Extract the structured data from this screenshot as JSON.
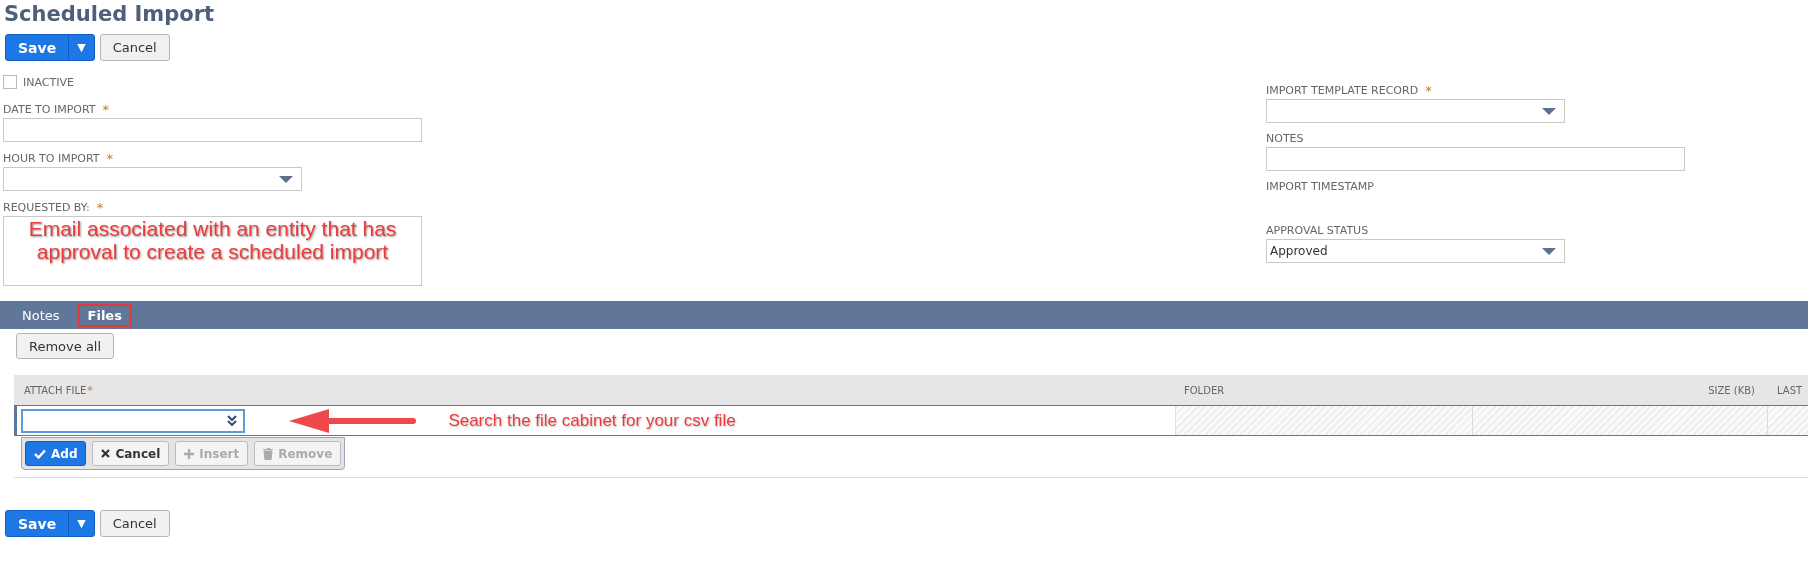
{
  "title": "Scheduled Import",
  "top_buttons": {
    "save": "Save",
    "menu": "▼",
    "cancel": "Cancel"
  },
  "inactive": {
    "label": "INACTIVE",
    "checked": false
  },
  "left_fields": [
    {
      "kind": "text",
      "label": "DATE TO IMPORT",
      "mark": "*"
    },
    {
      "kind": "select",
      "label": "HOUR TO IMPORT",
      "mark": "*"
    },
    {
      "kind": "textarea",
      "label": "REQUESTED BY:",
      "mark": "*",
      "annotation": "Email associated with an entity that has approval to create a scheduled import"
    }
  ],
  "right_fields": [
    {
      "kind": "select",
      "label": "IMPORT TEMPLATE RECORD",
      "mark": "*"
    },
    {
      "kind": "wide",
      "label": "NOTES"
    },
    {
      "kind": "readonly",
      "label": "IMPORT TIMESTAMP"
    },
    {
      "kind": "select",
      "label": "APPROVAL STATUS",
      "value": "Approved"
    }
  ],
  "tabs": [
    {
      "label": "Notes",
      "selected": false,
      "highlighted": false
    },
    {
      "label": "Files",
      "selected": true,
      "highlighted": true
    }
  ],
  "remove_all": "Remove all",
  "table": {
    "columns": [
      {
        "label": "ATTACH FILE",
        "mark": "*"
      },
      {
        "label": "FOLDER"
      },
      {
        "label": "SIZE (KB)"
      },
      {
        "label": "LAST"
      }
    ]
  },
  "row_buttons": [
    {
      "label": "Add",
      "kind": "add",
      "disabled": false,
      "primary": true
    },
    {
      "label": "Cancel",
      "kind": "cancel",
      "disabled": false,
      "primary": false
    },
    {
      "label": "Insert",
      "kind": "insert",
      "disabled": true,
      "primary": false
    },
    {
      "label": "Remove",
      "kind": "remove",
      "disabled": true,
      "primary": false
    }
  ],
  "file_annotation": "Search the file cabinet for your csv file",
  "bottom_buttons": {
    "save": "Save",
    "menu": "▼",
    "cancel": "Cancel"
  }
}
